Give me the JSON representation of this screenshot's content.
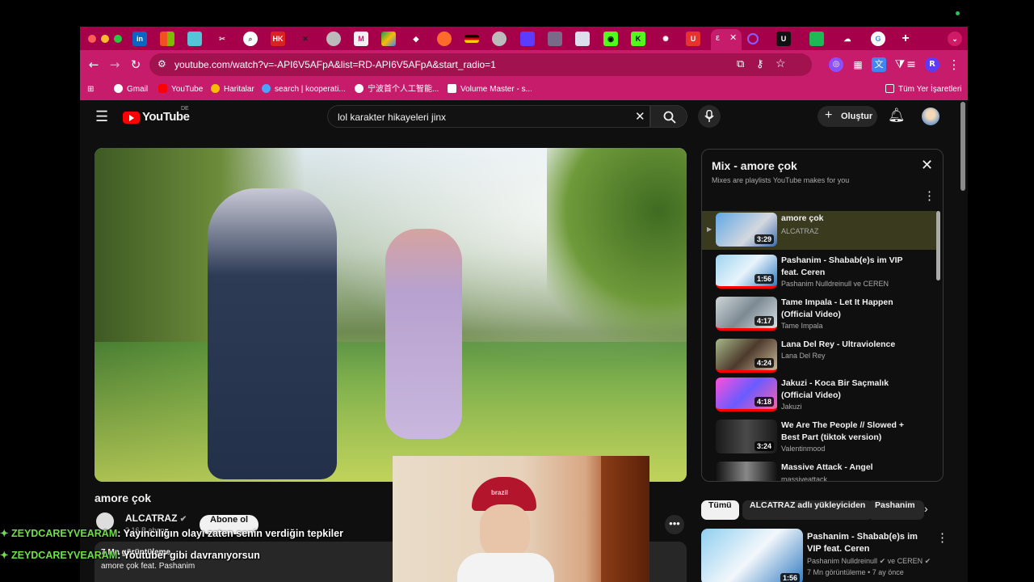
{
  "browser": {
    "url": "youtube.com/watch?v=-API6V5AFpA&list=RD-API6V5AFpA&start_radio=1",
    "active_tab_label": "ε",
    "bookmarks": [
      "Gmail",
      "YouTube",
      "Haritalar",
      "search | kooperati...",
      "宁波首个人工智能...",
      "Volume Master - s..."
    ],
    "all_bookmarks": "Tüm Yer İşaretleri",
    "profile_initial": "R"
  },
  "youtube": {
    "logo_text": "YouTube",
    "country": "DE",
    "search_value": "lol karakter hikayeleri jinx",
    "create_label": "Oluştur"
  },
  "video": {
    "title": "amore çok",
    "channel": "ALCATRAZ",
    "subscribers": "2,16 B abone",
    "subscribe_label": "Abone ol",
    "description_line": "amore çok feat. Pashanim",
    "description_prefix": "7 Mn görüntüleme"
  },
  "mix": {
    "title": "Mix - amore çok",
    "subtitle": "Mixes are playlists YouTube makes for you",
    "items": [
      {
        "title": "amore çok",
        "channel": "ALCATRAZ",
        "duration": "3:29"
      },
      {
        "title": "Pashanim - Shabab(e)s im VIP feat. Ceren",
        "channel": "Pashanim Nulldreinull ve CEREN",
        "duration": "1:56"
      },
      {
        "title": "Tame Impala - Let It Happen (Official Video)",
        "channel": "Tame Impala",
        "duration": "4:17"
      },
      {
        "title": "Lana Del Rey - Ultraviolence",
        "channel": "Lana Del Rey",
        "duration": "4:24"
      },
      {
        "title": "Jakuzi - Koca Bir Saçmalık (Official Video)",
        "channel": "Jakuzi",
        "duration": "4:18"
      },
      {
        "title": "We Are The People // Slowed + Best Part (tiktok version)",
        "channel": "Valentinmood",
        "duration": "3:24"
      },
      {
        "title": "Massive Attack - Angel",
        "channel": "massiveattack",
        "duration": ""
      }
    ]
  },
  "chips": [
    "Tümü",
    "ALCATRAZ adlı yükleyiciden",
    "Pashanim"
  ],
  "recommended": {
    "title": "Pashanim - Shabab(e)s im VIP feat. Ceren",
    "channel": "Pashanim Nulldreinull",
    "channel2": "ve CEREN",
    "meta": "7 Mn görüntüleme • 7 ay önce",
    "duration": "1:56"
  },
  "chat": [
    {
      "user": "ZEYDCAREYVEARAM",
      "message": ": Yayıncılığın olayı zaten senin verdiğin tepkiler"
    },
    {
      "user": "ZEYDCAREYVEARAM",
      "message": ": Youtuber gibi davranıyorsun"
    }
  ],
  "webcam": {
    "cap_text": "brazil"
  }
}
